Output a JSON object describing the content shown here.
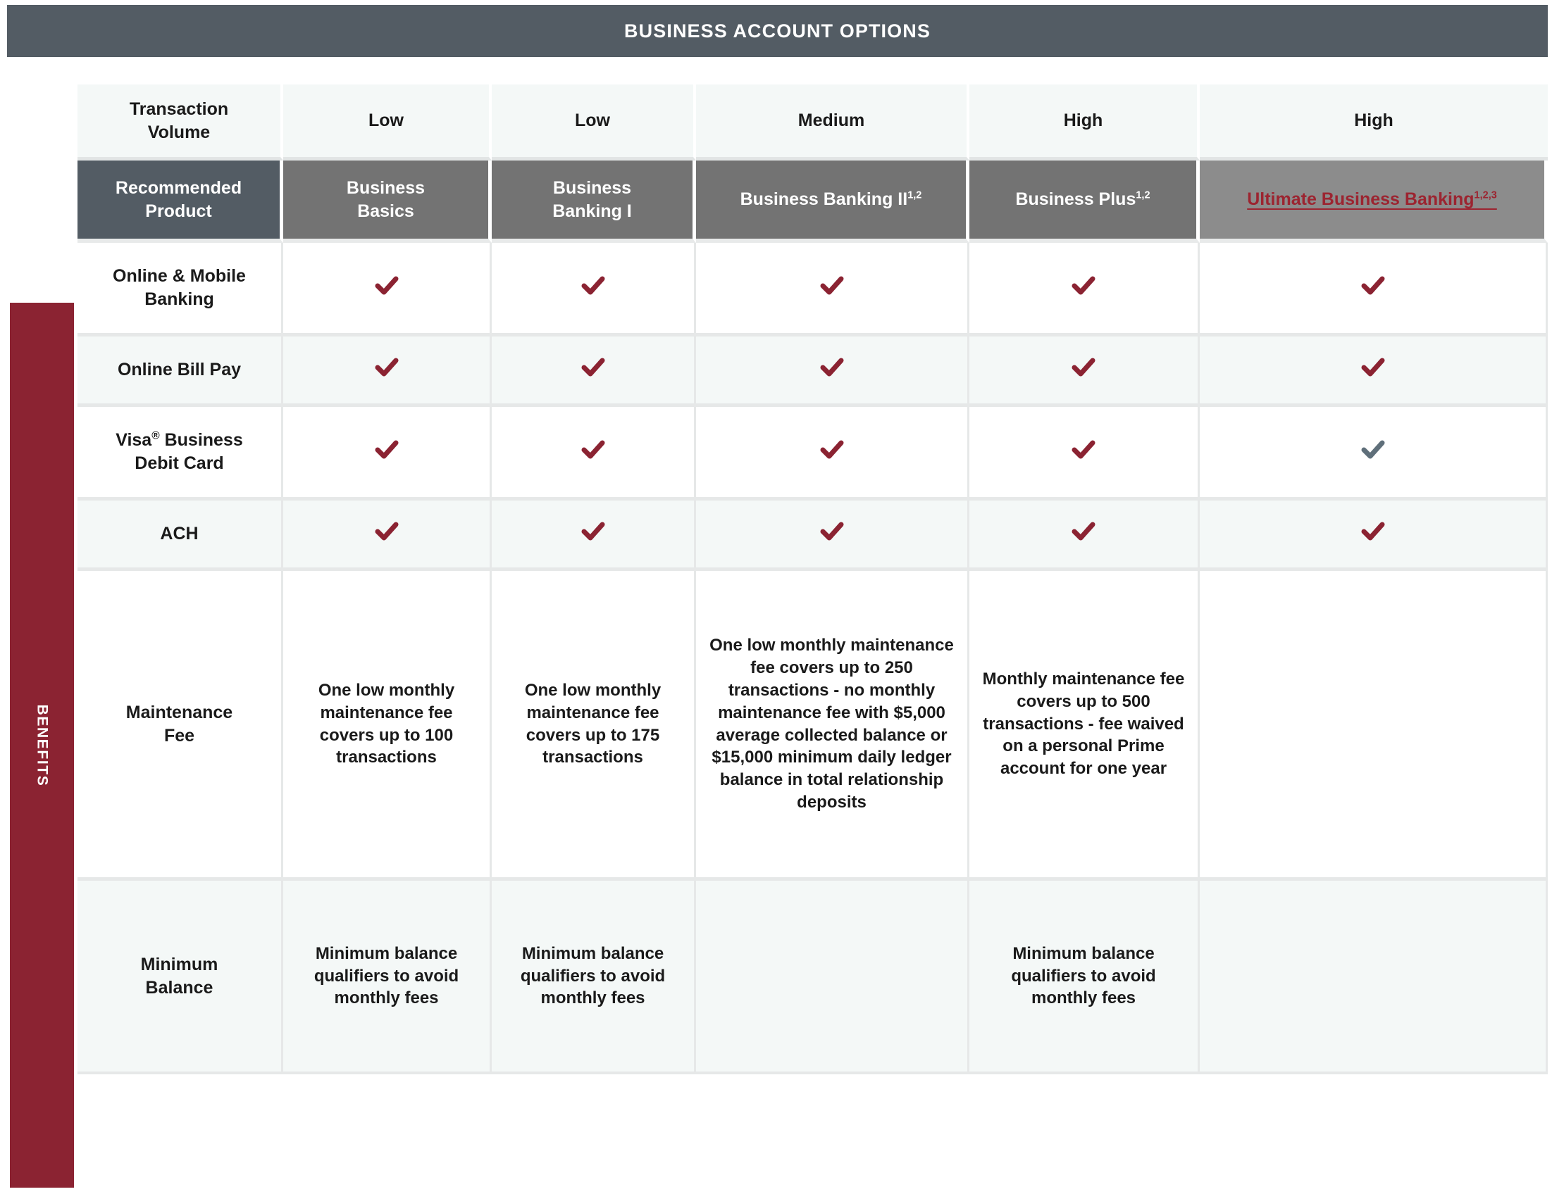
{
  "header": {
    "title": "BUSINESS ACCOUNT OPTIONS"
  },
  "sidebar": {
    "rail_label": "BENEFITS"
  },
  "colors": {
    "banner": "#535c64",
    "rail": "#8b2332",
    "product_header": "#737373",
    "product_header_featured": "#8c8c8c",
    "product_label_header": "#535c64",
    "check_active": "#8b2332",
    "check_muted": "#5f6f7a",
    "link": "#9c2430",
    "row_tint": "#f4f8f7",
    "row_plain": "#ffffff"
  },
  "table": {
    "row_headers": {
      "transaction_volume": "Transaction\nVolume",
      "transaction_volume_line1": "Transaction",
      "transaction_volume_line2": "Volume",
      "recommended_product_line1": "Recommended",
      "recommended_product_line2": "Product"
    },
    "transaction_volume": [
      "Low",
      "Low",
      "Medium",
      "High",
      "High"
    ],
    "products": [
      {
        "name_line1": "Business",
        "name_line2": "Basics",
        "footnotes": "",
        "featured": false,
        "is_link": false
      },
      {
        "name_line1": "Business",
        "name_line2": "Banking I",
        "footnotes": "",
        "featured": false,
        "is_link": false
      },
      {
        "name_line1": "Business Banking II",
        "name_line2": "",
        "footnotes": "1,2",
        "featured": false,
        "is_link": false
      },
      {
        "name_line1": "Business Plus",
        "name_line2": "",
        "footnotes": "1,2",
        "featured": false,
        "is_link": false
      },
      {
        "name_line1": "Ultimate Business Banking",
        "name_line2": "",
        "footnotes": "1,2,3",
        "featured": true,
        "is_link": true
      }
    ],
    "benefit_rows": [
      {
        "label_line1": "Online & Mobile",
        "label_line2": "Banking",
        "type": "check",
        "cells": [
          "check-red",
          "check-red",
          "check-red",
          "check-red",
          "check-red"
        ]
      },
      {
        "label_line1": "Online Bill Pay",
        "label_line2": "",
        "type": "check",
        "cells": [
          "check-red",
          "check-red",
          "check-red",
          "check-red",
          "check-red"
        ]
      },
      {
        "label_line1": "Visa® Business",
        "label_line2": "Debit Card",
        "label_has_reg": true,
        "label_reg_prefix": "Visa",
        "label_reg_suffix": " Business",
        "type": "check",
        "cells": [
          "check-red",
          "check-red",
          "check-red",
          "check-red",
          "check-gray"
        ]
      },
      {
        "label_line1": "ACH",
        "label_line2": "",
        "type": "check",
        "cells": [
          "check-red",
          "check-red",
          "check-red",
          "check-red",
          "check-red"
        ]
      },
      {
        "label_line1": "Maintenance",
        "label_line2": "Fee",
        "type": "text",
        "cells": [
          "One low monthly maintenance fee covers up to 100 transactions",
          "One low monthly maintenance fee covers up to 175 transactions",
          "One low monthly maintenance fee covers up to 250 transactions - no monthly maintenance fee with $5,000 average collected balance or $15,000 minimum daily ledger balance in total relationship deposits",
          "Monthly maintenance fee covers up to 500 transactions - fee waived on a personal Prime account for one year",
          ""
        ]
      },
      {
        "label_line1": "Minimum",
        "label_line2": "Balance",
        "type": "text",
        "cells": [
          "Minimum balance qualifiers to avoid monthly fees",
          "Minimum balance qualifiers to avoid monthly fees",
          "",
          "Minimum balance qualifiers to avoid monthly fees",
          ""
        ]
      }
    ]
  }
}
